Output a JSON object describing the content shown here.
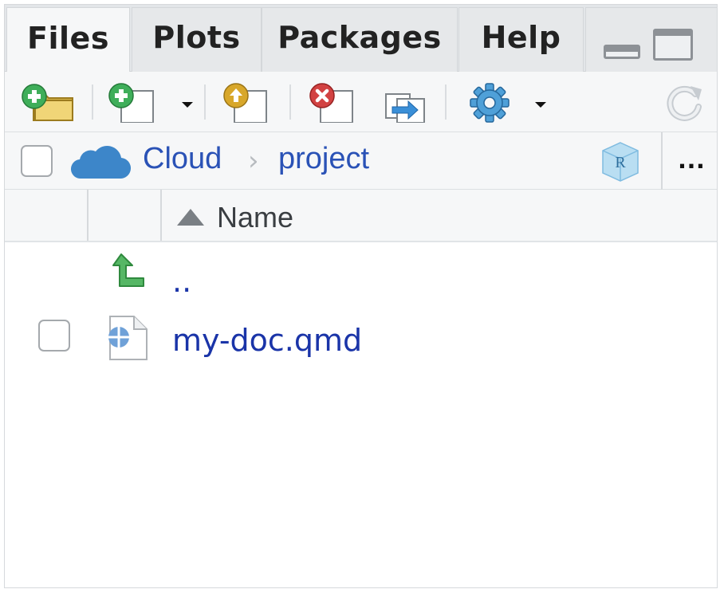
{
  "tabs": [
    {
      "label": "Files",
      "active": true
    },
    {
      "label": "Plots",
      "active": false
    },
    {
      "label": "Packages",
      "active": false
    },
    {
      "label": "Help",
      "active": false
    }
  ],
  "toolbar": {
    "icons": [
      "new-folder-icon",
      "new-blank-file-icon",
      "upload-icon",
      "delete-icon",
      "rename-icon",
      "more-gear-icon",
      "refresh-icon"
    ]
  },
  "breadcrumb": {
    "root": "Cloud",
    "separator": "›",
    "current": "project",
    "more": "…"
  },
  "columns": {
    "name": "Name",
    "sort": "ascending"
  },
  "rows": [
    {
      "name": "..",
      "type": "parent",
      "icon": "parent-folder-up-icon"
    },
    {
      "name": "my-doc.qmd",
      "type": "file",
      "icon": "quarto-file-icon"
    }
  ],
  "colors": {
    "link": "#1a34a8",
    "breadcrumb": "#2a52b6",
    "tab_bg": "#e6e8ea",
    "toolbar_bg": "#f6f7f8",
    "cloud": "#3d86c9"
  }
}
